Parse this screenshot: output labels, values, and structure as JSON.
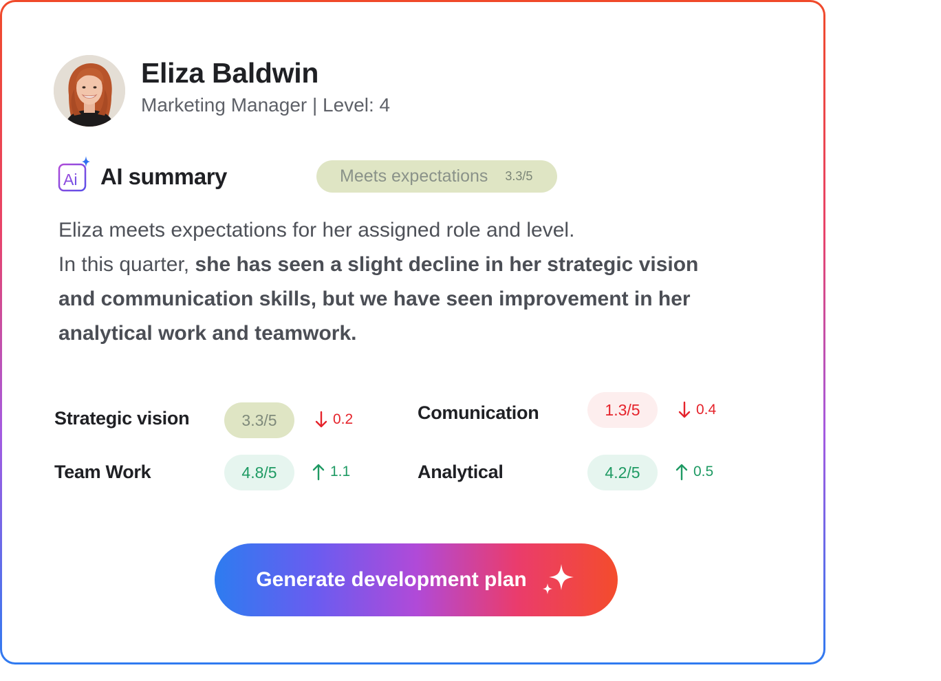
{
  "profile": {
    "name": "Eliza Baldwin",
    "role": "Marketing Manager | Level: 4",
    "avatar_icon": "person-avatar"
  },
  "summary_section": {
    "icon": "ai-sparkle-icon",
    "title": "AI summary",
    "status_label": "Meets expectations",
    "status_score": "3.3/5",
    "text_plain_1": "Eliza meets expectations for her assigned role and level.",
    "text_plain_2": "In this quarter, ",
    "text_bold": "she has seen a slight decline in her strategic vision and communication skills, but we have seen improvement in her analytical work and teamwork."
  },
  "metrics": [
    {
      "label": "Strategic vision",
      "score": "3.3/5",
      "delta": "0.2",
      "direction": "down",
      "tone": "neutral"
    },
    {
      "label": "Comunication",
      "score": "1.3/5",
      "delta": "0.4",
      "direction": "down",
      "tone": "bad"
    },
    {
      "label": "Team Work",
      "score": "4.8/5",
      "delta": "1.1",
      "direction": "up",
      "tone": "good"
    },
    {
      "label": "Analytical",
      "score": "4.2/5",
      "delta": "0.5",
      "direction": "up",
      "tone": "good"
    }
  ],
  "cta": {
    "label": "Generate development plan",
    "icon": "sparkle-icon"
  },
  "colors": {
    "border_top": "#f04a2a",
    "border_bottom": "#2f7af0",
    "good": "#1e9a63",
    "bad": "#e5232b",
    "neutral_pill": "#dfe5c4"
  }
}
